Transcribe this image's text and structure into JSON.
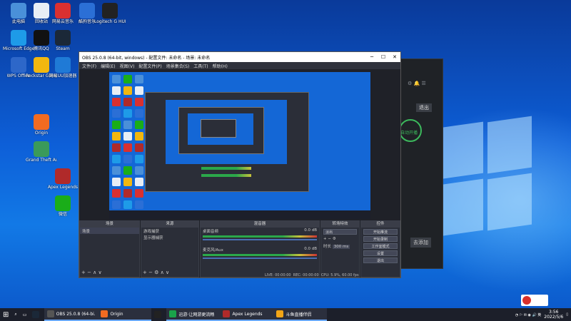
{
  "desktop_icons": [
    {
      "label": "此电脑",
      "color": "#4a90d9"
    },
    {
      "label": "回收站",
      "color": "#e8eef5"
    },
    {
      "label": "网易云音乐",
      "color": "#d93030"
    },
    {
      "label": "酷狗音乐",
      "color": "#2b6fd6"
    },
    {
      "label": "Logitech G HUB",
      "color": "#222"
    },
    {
      "label": "Microsoft Edge",
      "color": "#1e9be8"
    },
    {
      "label": "腾讯QQ",
      "color": "#111"
    },
    {
      "label": "Steam",
      "color": "#1b2838"
    },
    {
      "label": "Origin",
      "color": "#f26b21"
    },
    {
      "label": "Apex Legends",
      "color": "#b02a2a"
    },
    {
      "label": "WPS Office",
      "color": "#2d67c9"
    },
    {
      "label": "Rockstar Games",
      "color": "#f2b70f"
    },
    {
      "label": "网易UU加速器",
      "color": "#1f7ad6"
    },
    {
      "label": "Grand Theft Auto V",
      "color": "#3a9a5a"
    },
    {
      "label": "微信",
      "color": "#1aad19"
    }
  ],
  "obs": {
    "title": "OBS 25.0.8 (64-bit, windows) - 配置文件: 未命名 - 场景: 未命名",
    "menu": [
      "文件(F)",
      "编辑(E)",
      "视图(V)",
      "配置文件(P)",
      "场景集合(S)",
      "工具(T)",
      "帮助(H)"
    ],
    "docks": {
      "scenes": {
        "title": "场景",
        "items": [
          "场景"
        ]
      },
      "sources": {
        "title": "来源",
        "items": [
          "游戏捕获",
          "显示器捕获"
        ]
      },
      "mixer": {
        "title": "混音器",
        "tracks": [
          {
            "name": "桌面音频",
            "db": "0.0 dB"
          },
          {
            "name": "麦克风/Aux",
            "db": "0.0 dB"
          }
        ]
      },
      "transitions": {
        "title": "转场特效",
        "mode": "淡出",
        "duration_label": "时长",
        "duration": "300 ms"
      },
      "controls": {
        "title": "控件",
        "buttons": [
          "开始推流",
          "开始录制",
          "工作室模式",
          "设置",
          "退出"
        ]
      }
    },
    "status": {
      "live": "LIVE: 00:00:00",
      "rec": "REC: 00:00:00",
      "cpu": "CPU: 5.9%, 60.00 fps"
    }
  },
  "dark_app": {
    "btn1": "退出",
    "btn2": "自动开播",
    "btn3": "去添加"
  },
  "taskbar": {
    "tasks": [
      {
        "label": "OBS 25.0.8 (64-bi...",
        "color": "#555"
      },
      {
        "label": "Origin",
        "color": "#f26b21"
      },
      {
        "label": "",
        "color": "#222"
      },
      {
        "label": "迅游·让网游更流畅",
        "color": "#1aa34a"
      },
      {
        "label": "Apex Legends",
        "color": "#b02a2a"
      },
      {
        "label": "斗鱼直播伴侣",
        "color": "#f2a516"
      }
    ],
    "time": "3:56",
    "date": "2022/5/6"
  },
  "colors": {
    "obs_bg": "#2b2e38",
    "accent": "#6aa8ff"
  }
}
